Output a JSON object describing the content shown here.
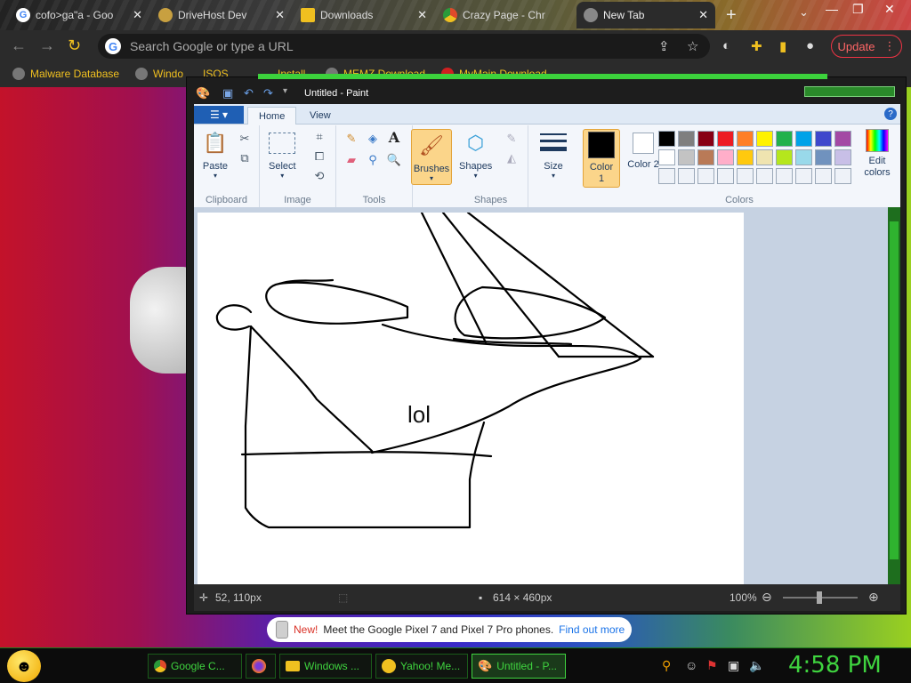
{
  "browser": {
    "tabs": [
      {
        "title": "cofo>ga\"a - Goo",
        "icon": "google-icon",
        "color": "#4285f4"
      },
      {
        "title": "DriveHost Dev",
        "icon": "drivehost-icon",
        "color": "#c8a040"
      },
      {
        "title": "Downloads",
        "icon": "download-icon",
        "color": "#f0c020"
      },
      {
        "title": "Crazy Page - Chr",
        "icon": "chrome-icon",
        "color": "#e04a2a"
      },
      {
        "title": "New Tab",
        "icon": "chrome-icon",
        "color": "#888888"
      }
    ],
    "new_tab": "+",
    "omnibox_placeholder": "Search Google or type a URL",
    "update_label": "Update",
    "bookmarks": [
      {
        "label": "Malware Database"
      },
      {
        "label": "Windo"
      },
      {
        "label": "ISOS"
      },
      {
        "label": "Install"
      },
      {
        "label": "MEMZ Download"
      },
      {
        "label": "MyMain Download"
      }
    ]
  },
  "paint": {
    "title": "Untitled - Paint",
    "file_menu": "☰ ▾",
    "tabs": [
      "Home",
      "View"
    ],
    "groups": {
      "clipboard": "Clipboard",
      "image": "Image",
      "tools": "Tools",
      "shapes": "Shapes",
      "colors": "Colors"
    },
    "buttons": {
      "paste": "Paste",
      "select": "Select",
      "brushes": "Brushes",
      "shapes": "Shapes",
      "size": "Size",
      "color1": "Color 1",
      "color2": "Color 2",
      "edit_colors": "Edit colors"
    },
    "palette": [
      "#000000",
      "#7f7f7f",
      "#880015",
      "#ed1c24",
      "#ff7f27",
      "#fff200",
      "#22b14c",
      "#00a2e8",
      "#3f48cc",
      "#a349a4",
      "#ffffff",
      "#c3c3c3",
      "#b97a57",
      "#ffaec9",
      "#ffc90e",
      "#efe4b0",
      "#b5e61d",
      "#99d9ea",
      "#7092be",
      "#c8bfe7",
      "",
      "",
      "",
      "",
      "",
      "",
      "",
      "",
      "",
      ""
    ],
    "canvas_text": "lol",
    "status": {
      "cursor": "52, 110px",
      "size": "614 × 460px",
      "zoom": "100%"
    }
  },
  "notification": {
    "new": "New!",
    "text": "Meet the Google Pixel 7 and Pixel 7 Pro phones.",
    "link": "Find out more"
  },
  "taskbar": {
    "items": [
      {
        "label": "Google C...",
        "icon": "chrome-icon"
      },
      {
        "label": "",
        "icon": "firefox-icon"
      },
      {
        "label": "Windows ...",
        "icon": "folder-icon"
      },
      {
        "label": "Yahoo! Me...",
        "icon": "yahoo-messenger-icon"
      },
      {
        "label": "Untitled - P...",
        "icon": "paint-icon"
      }
    ],
    "clock": "4:58 PM"
  }
}
